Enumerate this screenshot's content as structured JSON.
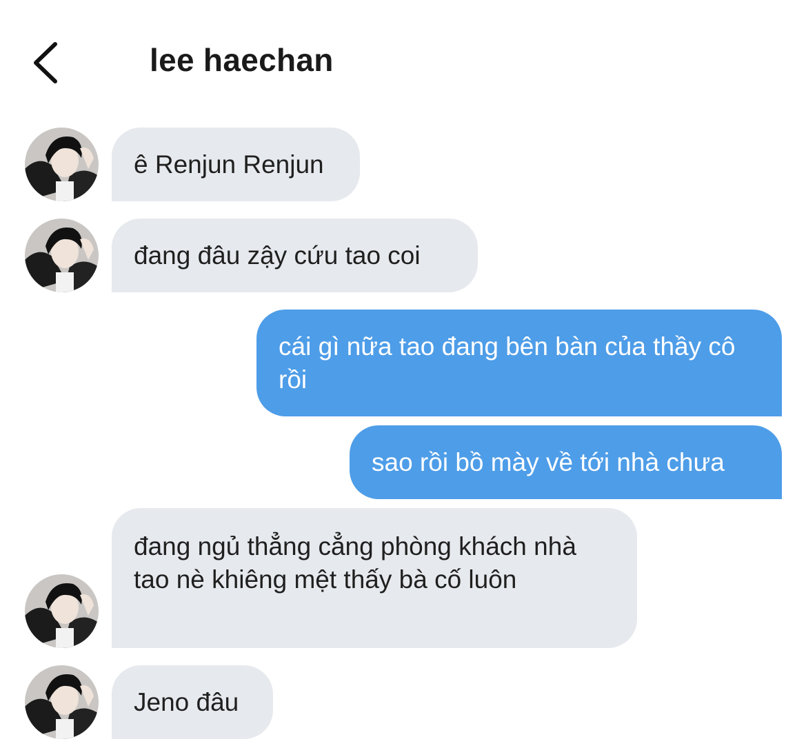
{
  "header": {
    "back_icon": "chevron-left-icon",
    "title": "lee haechan"
  },
  "colors": {
    "incoming_bubble": "#e6e9ed",
    "outgoing_bubble": "#4e9de8",
    "background": "#ffffff"
  },
  "messages": [
    {
      "direction": "in",
      "text": "ê Renjun Renjun"
    },
    {
      "direction": "in",
      "text": "đang đâu zậy cứu tao coi"
    },
    {
      "direction": "out",
      "text": "cái gì nữa tao đang bên bàn của thầy cô rồi"
    },
    {
      "direction": "out",
      "text": "sao rồi bồ mày về tới nhà chưa"
    },
    {
      "direction": "in",
      "text": "đang ngủ thẳng cẳng phòng khách nhà tao nè khiêng mệt thấy bà cố luôn"
    },
    {
      "direction": "in",
      "text": "Jeno đâu"
    }
  ]
}
